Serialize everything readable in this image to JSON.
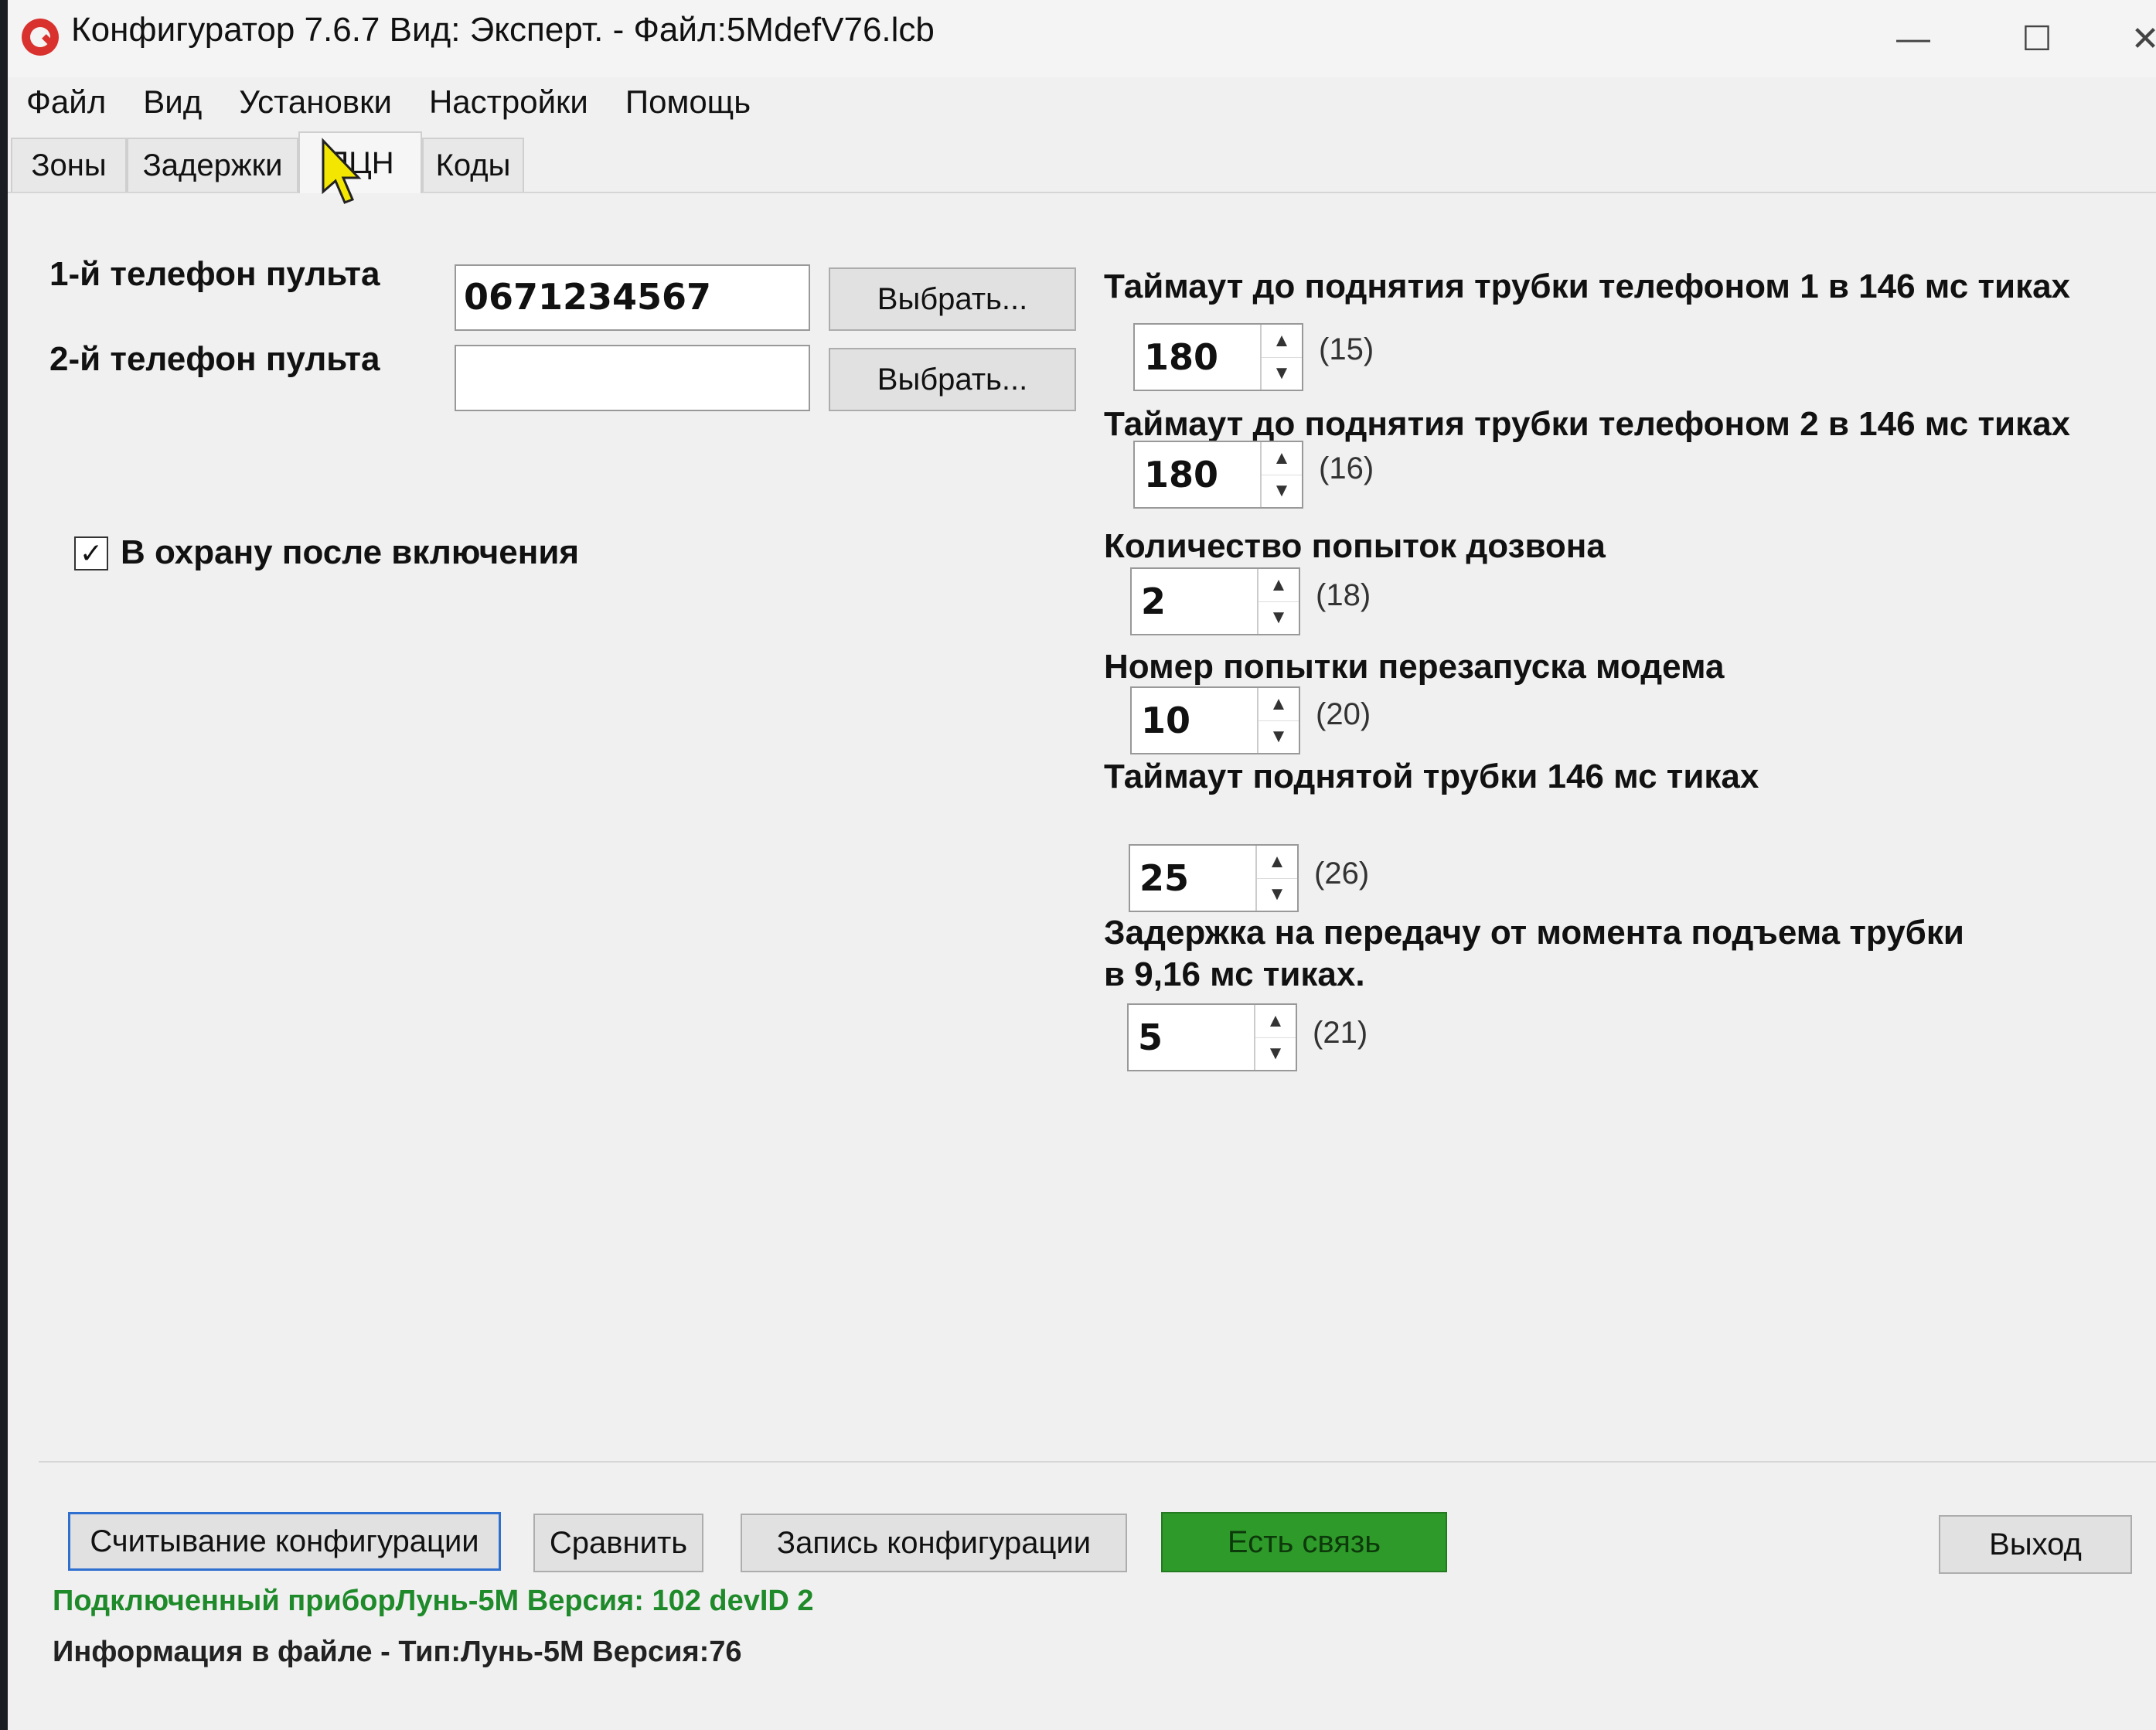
{
  "window": {
    "title": "Конфигуратор 7.6.7  Вид:  Эксперт. - Файл:5MdefV76.lcb",
    "controls": {
      "minimize": "—",
      "maximize": "☐",
      "close": "✕"
    }
  },
  "menu": [
    "Файл",
    "Вид",
    "Установки",
    "Настройки",
    "Помощь"
  ],
  "tabs": [
    "Зоны",
    "Задержки",
    "ПЦН",
    "Коды"
  ],
  "active_tab": "ПЦН",
  "phones": {
    "phone1": {
      "label": "1-й телефон пульта",
      "value": "0671234567",
      "button": "Выбрать..."
    },
    "phone2": {
      "label": "2-й телефон пульта",
      "value": "",
      "button": "Выбрать..."
    }
  },
  "arm_after_power": {
    "label": "В охрану после включения",
    "checked": true,
    "mark": "✓"
  },
  "params": [
    {
      "label": "Таймаут до поднятия трубки телефоном 1 в 146 мс тиках",
      "value": "180",
      "addr": "(15)"
    },
    {
      "label": "Таймаут до поднятия трубки телефоном 2 в 146 мс тиках",
      "value": "180",
      "addr": "(16)"
    },
    {
      "label": "Количество попыток дозвона",
      "value": "2",
      "addr": "(18)"
    },
    {
      "label": "Номер попытки перезапуска модема",
      "value": "10",
      "addr": "(20)"
    },
    {
      "label": "Таймаут поднятой трубки 146 мс тиках",
      "value": "25",
      "addr": "(26)"
    },
    {
      "label": "Задержка на передачу от момента подъема трубки в 9,16 мс тиках.",
      "value": "5",
      "addr": "(21)"
    }
  ],
  "bottom_buttons": {
    "read": "Считывание конфигурации",
    "compare": "Сравнить",
    "write": "Запись конфигурации",
    "connection": "Есть связь",
    "exit": "Выход"
  },
  "colors": {
    "connection_bg": "#2e9a2a",
    "connected_text": "#1e8a2a"
  },
  "status": {
    "connected_device": "Подключенный приборЛунь-5М Версия: 102 devID 2",
    "file_info": "Информация в файле - Тип:Лунь-5М Версия:76"
  }
}
